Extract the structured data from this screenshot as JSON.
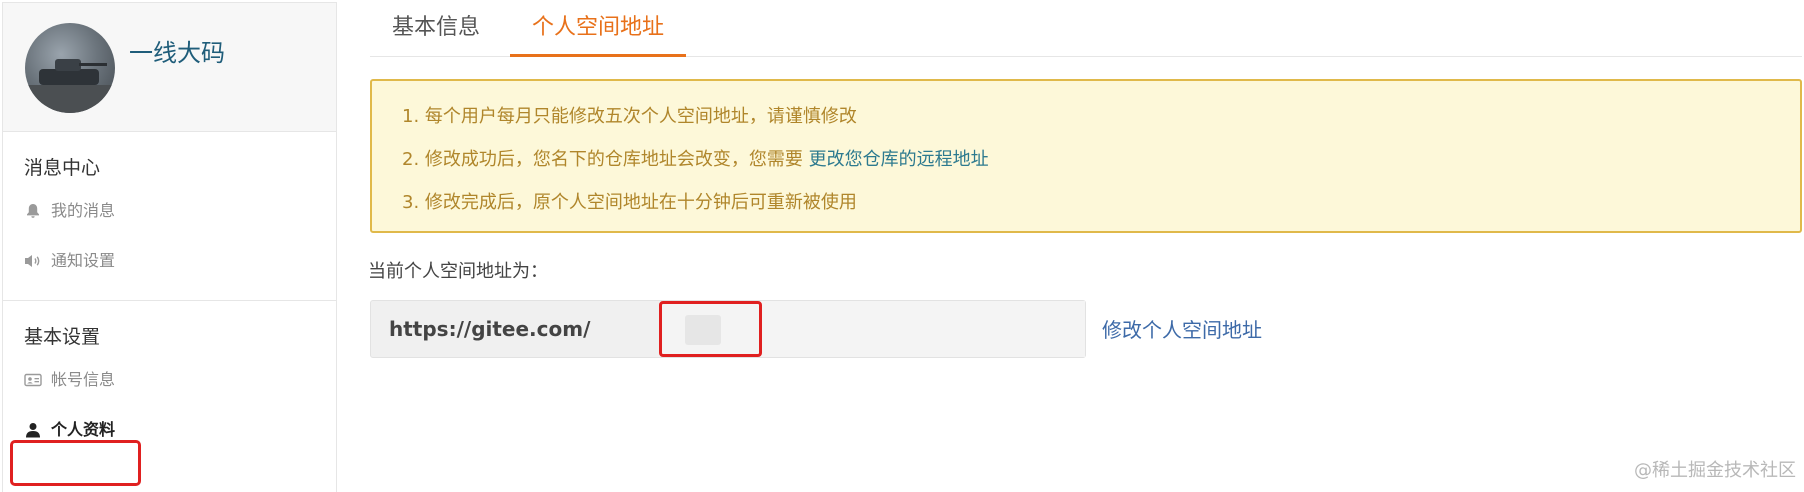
{
  "profile": {
    "username": "一线大码",
    "avatar_icon": "tank-avatar"
  },
  "sidebar": {
    "sections": [
      {
        "title": "消息中心",
        "items": [
          {
            "label": "我的消息",
            "icon": "bell-icon"
          },
          {
            "label": "通知设置",
            "icon": "speaker-icon"
          }
        ]
      },
      {
        "title": "基本设置",
        "items": [
          {
            "label": "帐号信息",
            "icon": "id-card-icon"
          },
          {
            "label": "个人资料",
            "icon": "user-icon",
            "active": true
          }
        ]
      }
    ]
  },
  "tabs": [
    {
      "label": "基本信息",
      "active": false
    },
    {
      "label": "个人空间地址",
      "active": true
    }
  ],
  "notice": {
    "line1": "1. 每个用户每月只能修改五次个人空间地址，请谨慎修改",
    "line2_prefix": "2. 修改成功后，您名下的仓库地址会改变，您需要 ",
    "line2_link": "更改您仓库的远程地址",
    "line3": "3. 修改完成后，原个人空间地址在十分钟后可重新被使用"
  },
  "address": {
    "label": "当前个人空间地址为：",
    "prefix": "https://gitee.com/",
    "value": "",
    "modify_link": "修改个人空间地址"
  },
  "watermark": "@稀土掘金技术社区",
  "colors": {
    "accent": "#e8711a",
    "link": "#3d6aa8",
    "highlight_box": "#e02020",
    "notice_bg": "#fdf8d9",
    "notice_text": "#b0862b"
  }
}
